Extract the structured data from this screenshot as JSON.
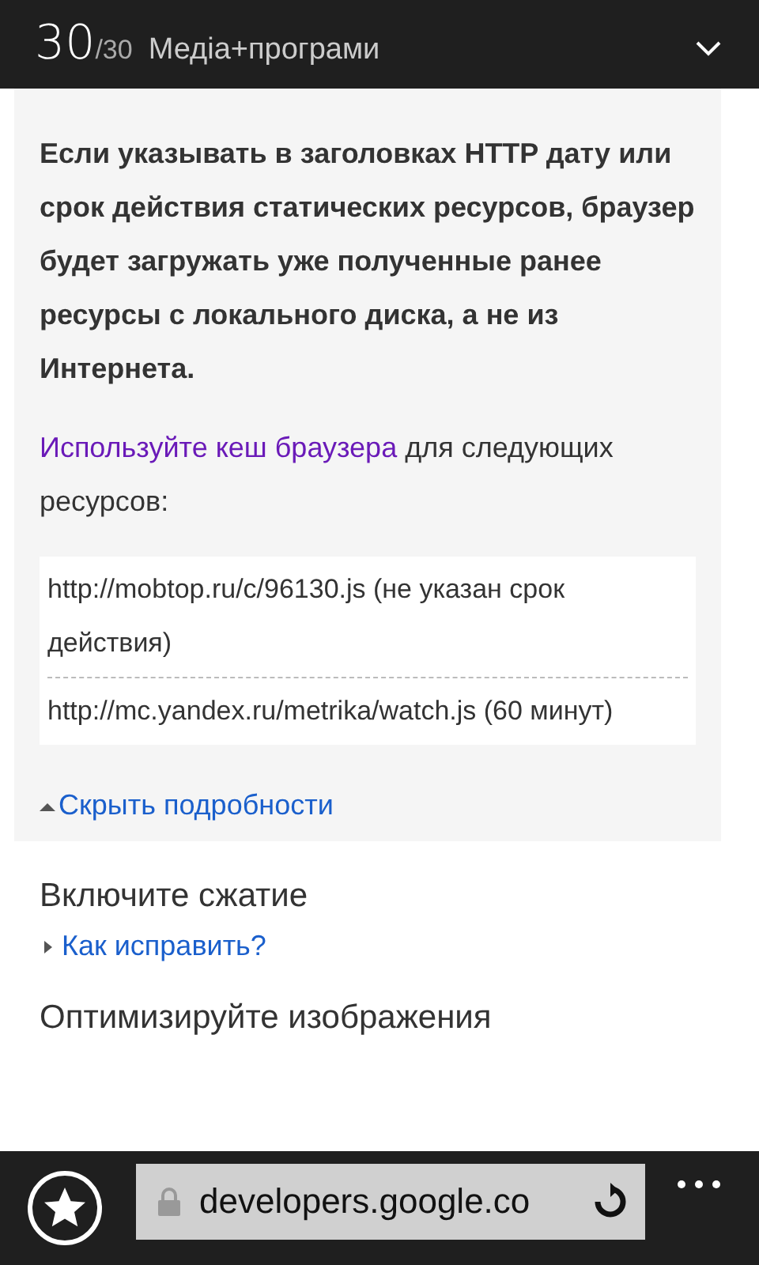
{
  "header": {
    "tab_number": "30",
    "tab_total": "/30",
    "title": "Медіа+програми"
  },
  "details": {
    "intro": "Если указывать в заголовках HTTP дату или срок действия статических ресурсов, браузер будет загружать уже полученные ранее ресурсы с локального диска, а не из Интернета.",
    "link": "Используйте кеш браузера",
    "link_rest": "для следующих ресурсов:",
    "resources": [
      "http://mobtop.ru/c/96130.js (не указан срок действия)",
      "http://mc.yandex.ru/metrika/watch.js (60 минут)"
    ],
    "toggle": {
      "label": "Скрыть подробности",
      "expanded": true
    }
  },
  "sections": [
    {
      "title": "Включите сжатие",
      "toggle": {
        "label": "Как исправить?",
        "expanded": false
      }
    },
    {
      "title": "Оптимизируйте изображения"
    }
  ],
  "address_bar": {
    "url": "developers.google.co"
  }
}
